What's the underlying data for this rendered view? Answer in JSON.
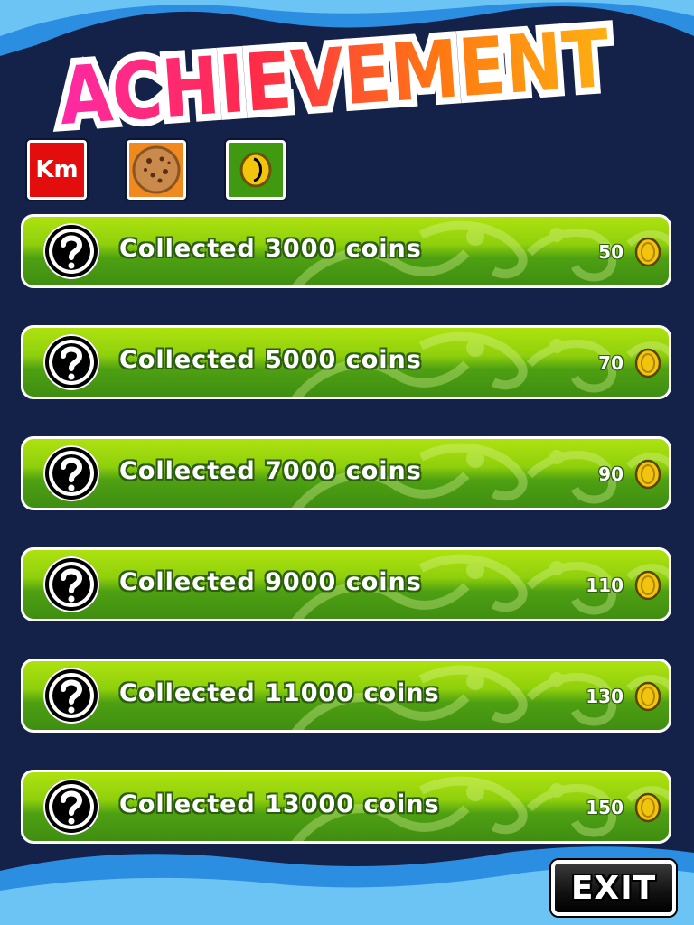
{
  "title": "ACHIEVEMENT",
  "tabs": [
    {
      "label": "Km",
      "icon": "km-icon"
    },
    {
      "label": "",
      "icon": "cookie-icon"
    },
    {
      "label": "",
      "icon": "coin-icon"
    }
  ],
  "achievements": [
    {
      "text": "Collected 3000 coins",
      "reward": "50"
    },
    {
      "text": "Collected 5000 coins",
      "reward": "70"
    },
    {
      "text": "Collected 7000 coins",
      "reward": "90"
    },
    {
      "text": "Collected 9000 coins",
      "reward": "110"
    },
    {
      "text": "Collected 11000 coins",
      "reward": "130"
    },
    {
      "text": "Collected 13000 coins",
      "reward": "150"
    }
  ],
  "exit_label": "EXIT",
  "colors": {
    "background": "#14224a",
    "row_top": "#aee20f",
    "row_bottom": "#3f8e12",
    "tab_km": "#e30d0d",
    "tab_cookie": "#f08a1e",
    "tab_coin": "#3f9a12"
  }
}
